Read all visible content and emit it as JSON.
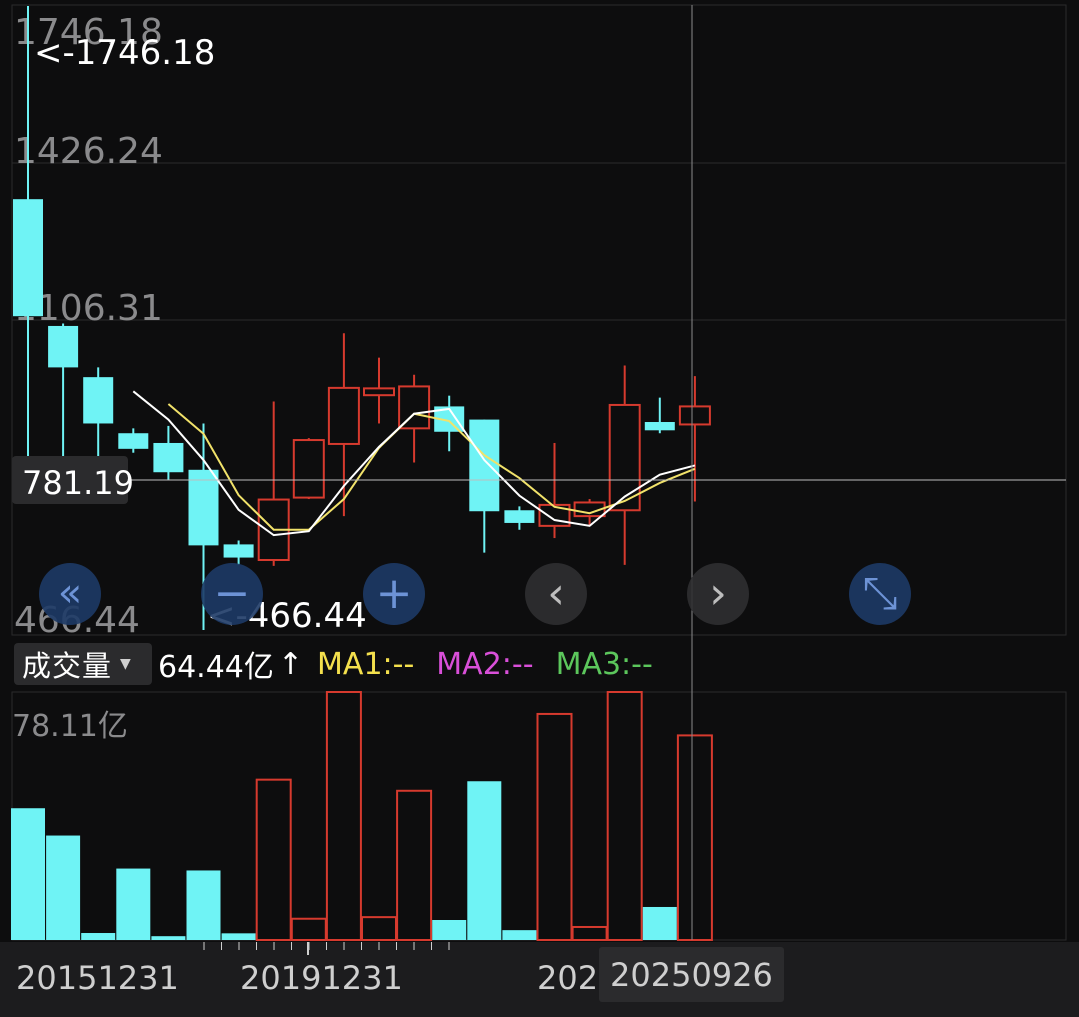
{
  "colors": {
    "background": "#0d0d0e",
    "up": "#d63a2e",
    "down": "#6ff3f5",
    "ma_white": "#ffffff",
    "ma_yellow": "#f1e26a",
    "ma1": "#f4e04d",
    "ma2": "#d94fd9",
    "ma3": "#5cc75c",
    "grid": "#2a2a2c",
    "label_gray": "#8a8a8c",
    "nav_button": "#1d3a66"
  },
  "price_axis": {
    "labels": [
      "1746.18",
      "1426.24",
      "1106.31",
      "781.19",
      "466.44"
    ],
    "max_marker": "<-1746.18",
    "min_marker": "<-466.44",
    "cursor_value": "781.19"
  },
  "volume_panel": {
    "selector_label": "成交量",
    "current_value": "64.44亿",
    "arrow": "↑",
    "ma1_text": "MA1:--",
    "ma2_text": "MA2:--",
    "ma3_text": "MA3:--",
    "top_label": "78.11亿"
  },
  "x_axis": {
    "labels": [
      "20151231",
      "20191231",
      "2025"
    ],
    "cursor_date": "20250926"
  },
  "nav_buttons": [
    {
      "name": "rewind-icon",
      "glyph": "«"
    },
    {
      "name": "zoom-out-icon",
      "glyph": "−"
    },
    {
      "name": "zoom-in-icon",
      "glyph": "+"
    },
    {
      "name": "prev-icon",
      "glyph": "‹"
    },
    {
      "name": "next-icon",
      "glyph": "›"
    },
    {
      "name": "fullscreen-icon",
      "glyph": "⤡"
    }
  ],
  "chart_data": {
    "type": "candlestick",
    "price_range": [
      466.44,
      1746.18
    ],
    "volume_max": 78.11,
    "candles": [
      {
        "open": 1350,
        "close": 1110,
        "high": 1746.18,
        "low": 770,
        "volume": 41.5
      },
      {
        "open": 1090,
        "close": 1005,
        "high": 1095,
        "low": 765,
        "volume": 32.9
      },
      {
        "open": 985,
        "close": 890,
        "high": 1005,
        "low": 770,
        "volume": 2.2
      },
      {
        "open": 870,
        "close": 838,
        "high": 880,
        "low": 830,
        "volume": 22.5
      },
      {
        "open": 850,
        "close": 790,
        "high": 885,
        "low": 775,
        "volume": 1.2
      },
      {
        "open": 795,
        "close": 640,
        "high": 890,
        "low": 466.44,
        "volume": 21.9
      },
      {
        "open": 642,
        "close": 615,
        "high": 650,
        "low": 600,
        "volume": 2.1
      },
      {
        "open": 610,
        "close": 734,
        "high": 935,
        "low": 598,
        "volume": 50.5
      },
      {
        "open": 738,
        "close": 856,
        "high": 860,
        "low": 735,
        "volume": 6.7
      },
      {
        "open": 848,
        "close": 963,
        "high": 1075,
        "low": 700,
        "volume": 78.11
      },
      {
        "open": 948,
        "close": 962,
        "high": 1025,
        "low": 890,
        "volume": 7.2
      },
      {
        "open": 880,
        "close": 966,
        "high": 990,
        "low": 810,
        "volume": 47.0
      },
      {
        "open": 925,
        "close": 873,
        "high": 947,
        "low": 833,
        "volume": 6.3
      },
      {
        "open": 898,
        "close": 710,
        "high": 898,
        "low": 625,
        "volume": 50.0
      },
      {
        "open": 712,
        "close": 686,
        "high": 720,
        "low": 672,
        "volume": 3.1
      },
      {
        "open": 680,
        "close": 723,
        "high": 850,
        "low": 655,
        "volume": 71.2
      },
      {
        "open": 700,
        "close": 728,
        "high": 735,
        "low": 680,
        "volume": 4.1
      },
      {
        "open": 712,
        "close": 928,
        "high": 1009,
        "low": 600,
        "volume": 78.11
      },
      {
        "open": 893,
        "close": 876,
        "high": 943,
        "low": 870,
        "volume": 10.4
      },
      {
        "open": 888,
        "close": 925,
        "high": 987,
        "low": 730,
        "volume": 64.44
      }
    ],
    "ma_white": [
      null,
      null,
      null,
      956,
      898,
      815,
      713,
      661,
      669,
      762,
      842,
      910,
      920,
      815,
      742,
      692,
      680,
      740,
      785,
      804
    ],
    "ma_yellow": [
      null,
      null,
      null,
      null,
      930,
      869,
      743,
      672,
      672,
      735,
      840,
      910,
      895,
      825,
      778,
      719,
      706,
      731,
      768,
      797
    ]
  }
}
